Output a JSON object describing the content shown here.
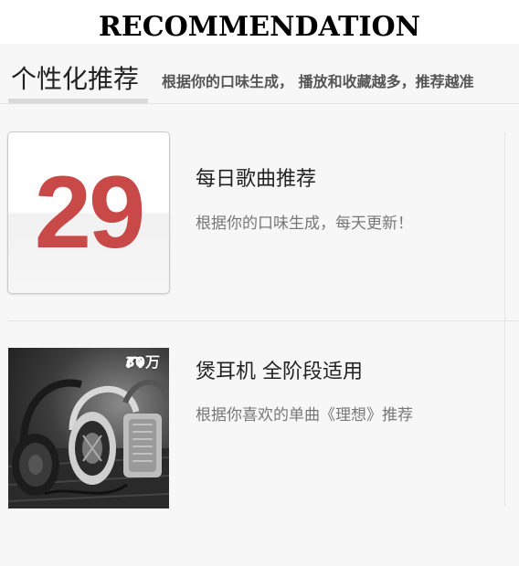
{
  "banner": {
    "title": "RECOMMENDATION"
  },
  "tab": {
    "title": "个性化推荐",
    "subtitle": "根据你的口味生成， 播放和收藏越多，推荐越准"
  },
  "items": [
    {
      "thumbnail": "calendar-icon",
      "calendar_day": "29",
      "title": "每日歌曲推荐",
      "description": "根据你的口味生成，每天更新！"
    },
    {
      "thumbnail": "headphones-photo",
      "play_count": "30万",
      "play_count_icon": "headphone-icon",
      "title": "煲耳机 全阶段适用",
      "description": "根据你喜欢的单曲《理想》推荐"
    }
  ],
  "colors": {
    "calendar_red": "#c94848",
    "title_text": "#222222",
    "desc_text": "#777777",
    "background": "#f7f7f7"
  }
}
